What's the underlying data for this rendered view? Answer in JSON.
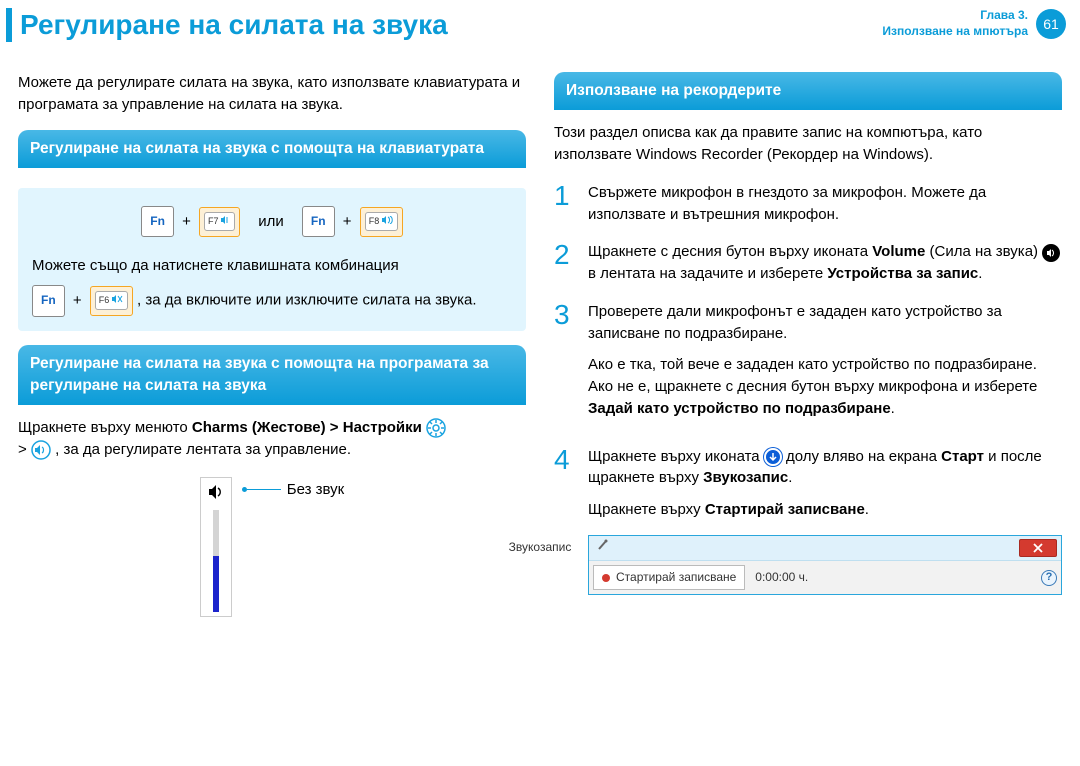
{
  "header": {
    "title": "Регулиране на силата на звука",
    "chapter_line1": "Глава 3.",
    "chapter_line2": "Използване на мпютъра",
    "page": "61"
  },
  "left": {
    "intro": "Можете да регулирате силата на звука, като използвате клавиатурата и програмата за управление на силата на звука.",
    "section1_title": "Регулиране на силата на звука с помощта на клавиатурата",
    "keys": {
      "fn": "Fn",
      "f7": "F7",
      "f8": "F8",
      "f6": "F6",
      "or": "или"
    },
    "kb_line1": "Можете също да натиснете клавишната комбинация",
    "kb_line2_tail": " , за да включите или изключите силата на звука.",
    "section2_title": "Регулиране на силата на звука с помощта на програмата за регулиране на силата на звука",
    "charms_pre": "Щракнете върху менюто ",
    "charms_bold": "Charms (Жестове) > Настройки",
    "charms_post": " , за да регулирате лентата за управление.",
    "mute_label": "Без звук"
  },
  "right": {
    "section_title": "Използване на рекордерите",
    "intro": "Този раздел описва как да правите запис на компютъра, като използвате Windows Recorder (Рекордер на Windows).",
    "step1": "Свържете микрофон в гнездото за микрофон. Можете да използвате и вътрешния микрофон.",
    "step2_pre": "Щракнете с десния бутон върху иконата ",
    "step2_vol": "Volume",
    "step2_mid": " (Сила на звука) ",
    "step2_post1": " в лентата на задачите и изберете ",
    "step2_bold": "Устройства за запис",
    "step3_a": "Проверете дали микрофонът е зададен като устройство за записване по подразбиране.",
    "step3_b_pre": "Ако е тка, той вече е зададен като устройство по подразбиране. Ако не е, щракнете с десния бутон върху микрофона и изберете ",
    "step3_b_bold": "Задай като устройство по подразбиране",
    "step4_pre": "Щракнете върху иконата ",
    "step4_mid": " долу вляво на екрана ",
    "step4_start": "Старт",
    "step4_post1": " и после щракнете върху ",
    "step4_bold1": "Звукозапис",
    "step4_line2_pre": "Щракнете върху ",
    "step4_line2_bold": "Стартирай записване",
    "recorder": {
      "title": "Звукозапис",
      "button": "Стартирай записване",
      "time": "0:00:00 ч."
    },
    "nums": {
      "n1": "1",
      "n2": "2",
      "n3": "3",
      "n4": "4"
    }
  }
}
